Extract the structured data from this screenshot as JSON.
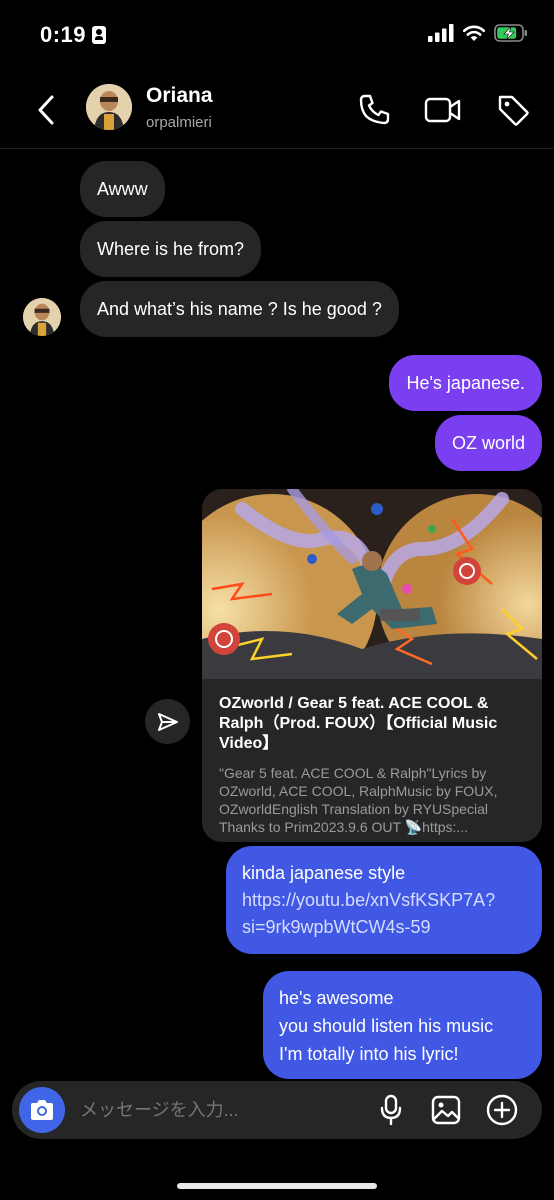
{
  "status": {
    "time": "0:19"
  },
  "header": {
    "name": "Oriana",
    "handle": "orpalmieri"
  },
  "messages": {
    "m1": "Awww",
    "m2": "Where is he from?",
    "m3": "And what’s his name ? Is he good ?",
    "m4": "He's japanese.",
    "m5": "OZ world",
    "m7_line1": "kinda japanese style",
    "m7_link1": "https://youtu.be/xnVsfKSKP7A?",
    "m7_link2": "si=9rk9wpbWtCW4s-59",
    "m8_line1": "he's awesome",
    "m8_line2": "you should listen his music",
    "m8_line3": "I'm totally into his lyric!"
  },
  "link_card": {
    "title": "OZworld / Gear 5 feat. ACE COOL & Ralph（Prod. FOUX）【Official Music Video】",
    "description": "\"Gear 5 feat. ACE COOL & Ralph\"Lyrics by OZworld, ACE COOL, RalphMusic by FOUX, OZworldEnglish Translation by RYUSpecial Thanks to Prim2023.9.6 OUT 📡https:..."
  },
  "composer": {
    "placeholder": "メッセージを入力..."
  },
  "colors": {
    "background": "#000000",
    "incoming_bubble": "#262626",
    "outgoing_purple": "#7a3ff0",
    "outgoing_blue": "#4058e3",
    "camera_button": "#3f66e6",
    "battery_green": "#34c759"
  },
  "icons": {
    "back": "chevron-left-icon",
    "call": "phone-icon",
    "video": "video-camera-icon",
    "tag": "tag-icon",
    "share": "send-icon",
    "camera": "camera-icon",
    "mic": "microphone-icon",
    "gallery": "image-icon",
    "add": "plus-circle-icon"
  }
}
